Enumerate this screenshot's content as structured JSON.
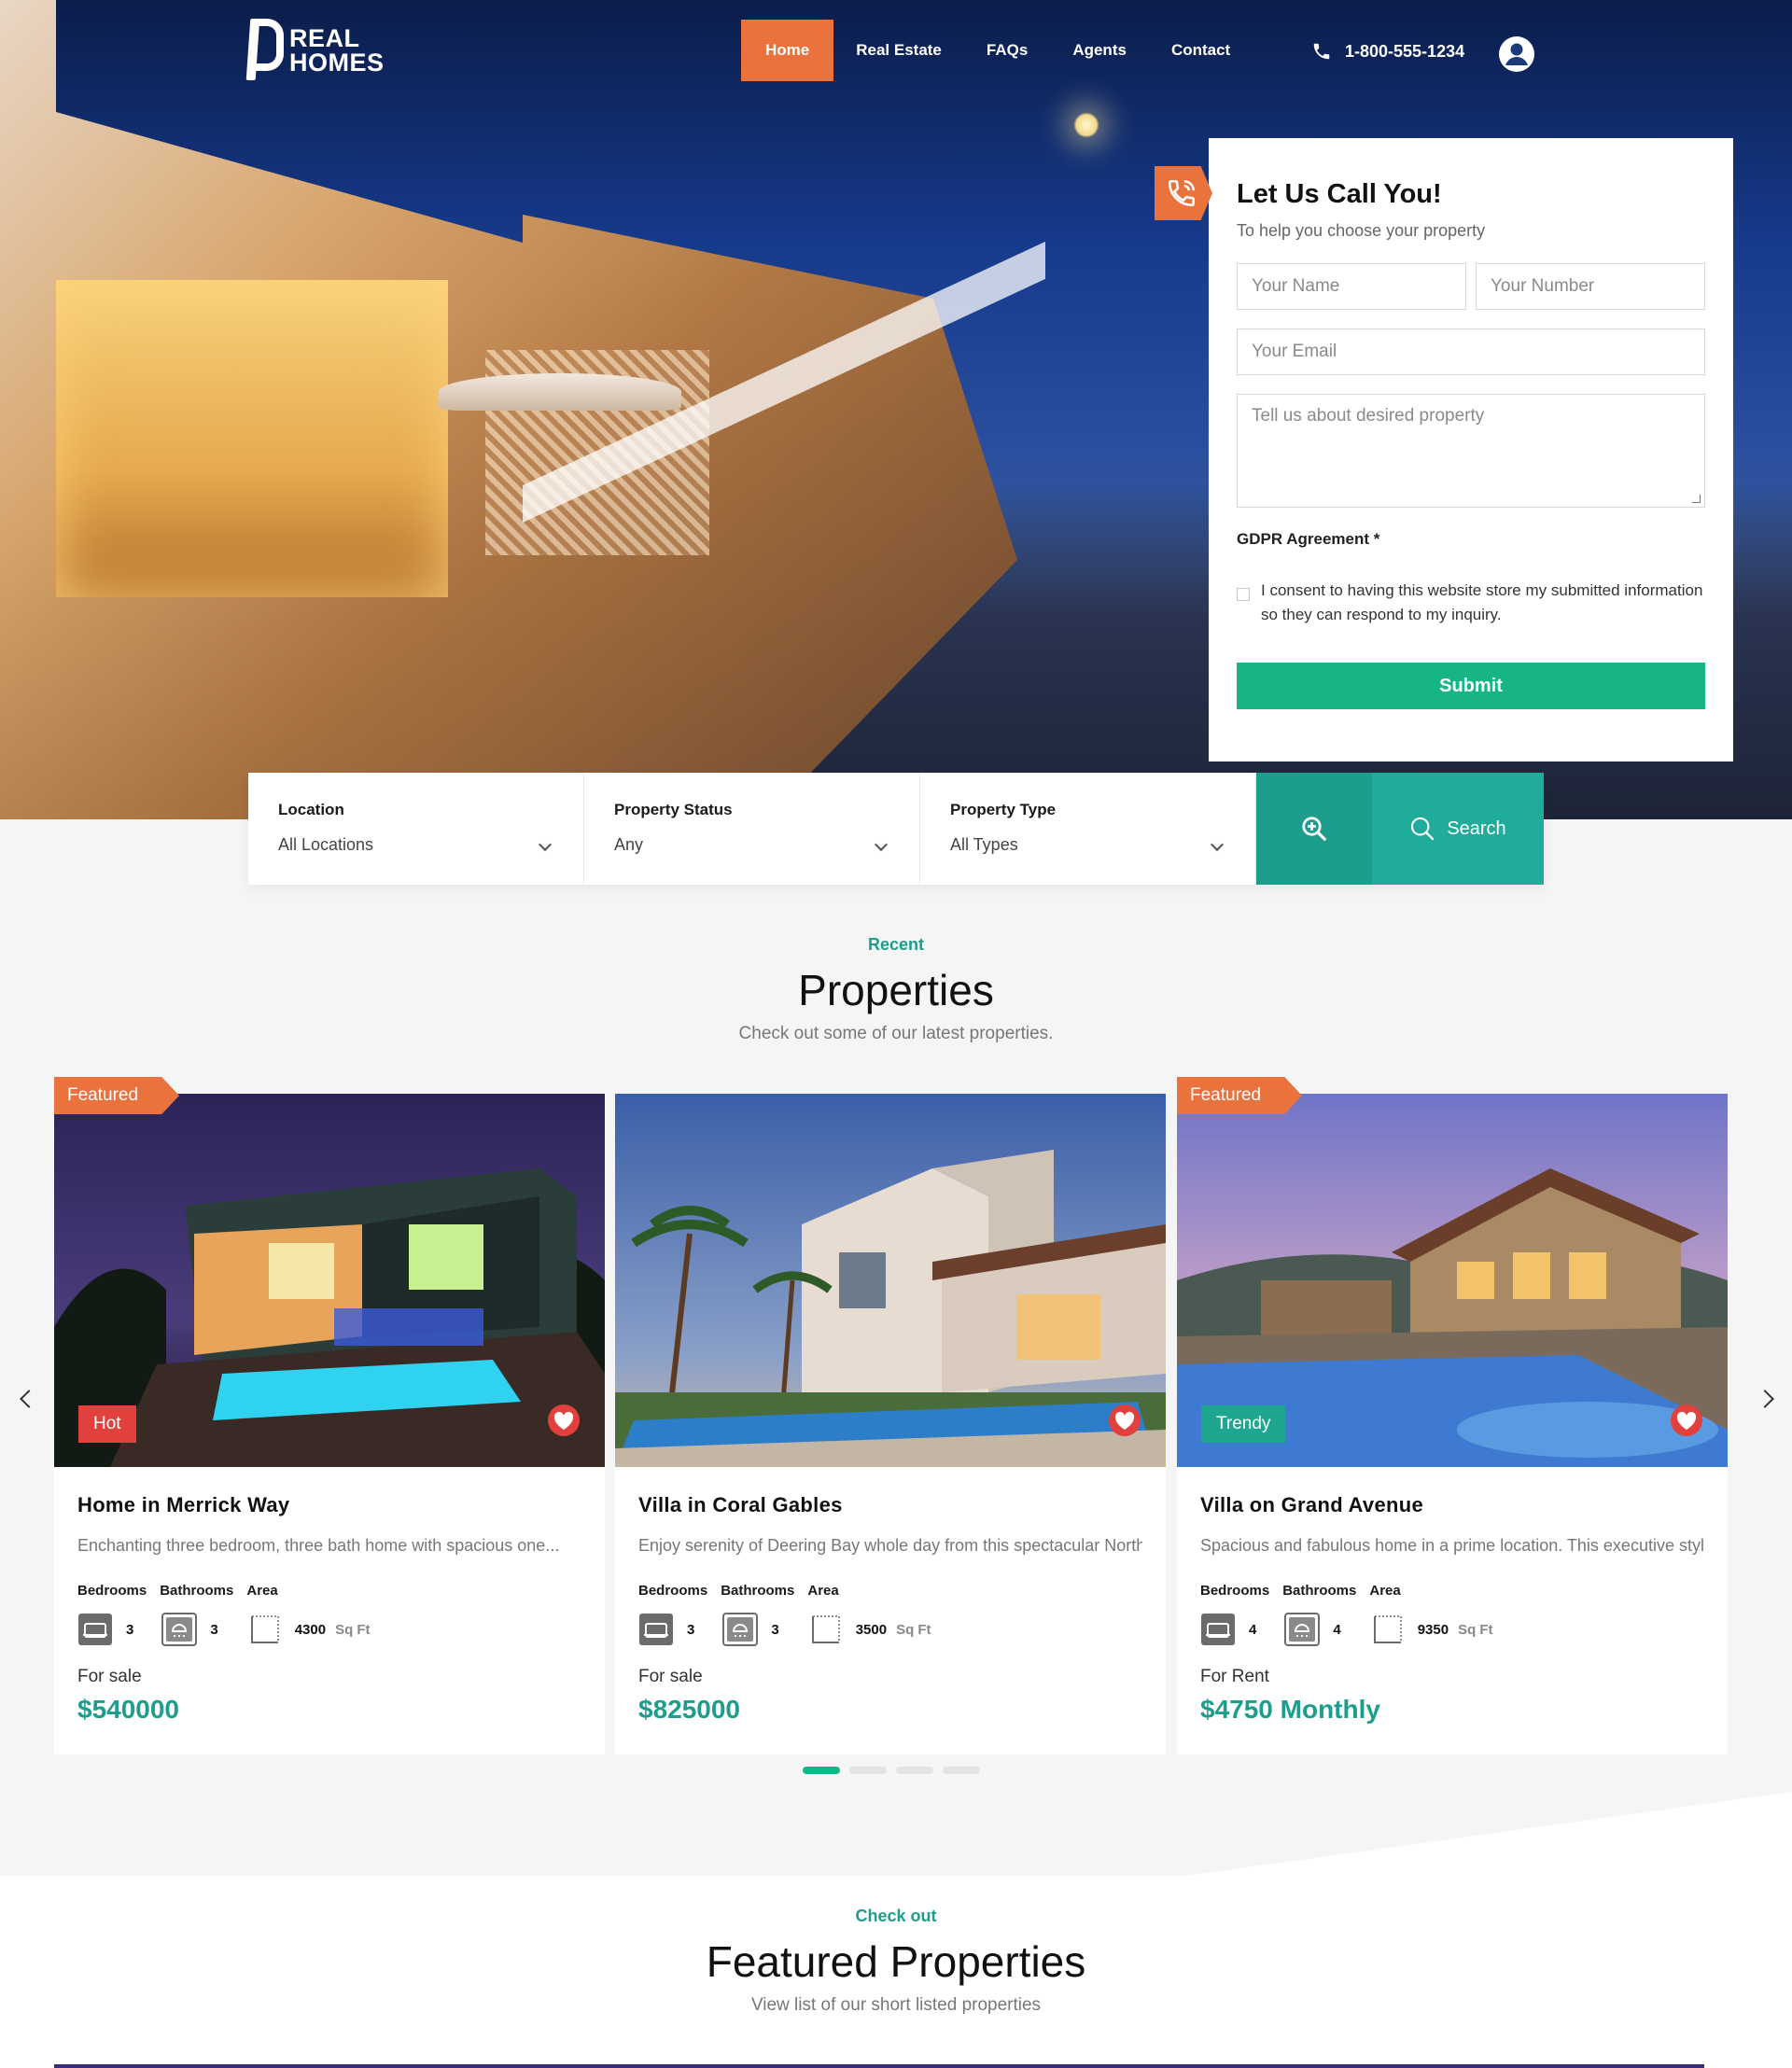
{
  "brand": {
    "name_line1": "REAL",
    "name_line2": "HOMES"
  },
  "nav": {
    "items": [
      {
        "label": "Home",
        "active": true
      },
      {
        "label": "Real Estate",
        "active": false
      },
      {
        "label": "FAQs",
        "active": false
      },
      {
        "label": "Agents",
        "active": false
      },
      {
        "label": "Contact",
        "active": false
      }
    ],
    "phone": "1-800-555-1234"
  },
  "callback": {
    "title": "Let Us Call You!",
    "subtitle": "To help you choose your property",
    "name_placeholder": "Your Name",
    "number_placeholder": "Your Number",
    "email_placeholder": "Your Email",
    "message_placeholder": "Tell us about desired property",
    "gdpr_title": "GDPR Agreement *",
    "consent_text": "I consent to having this website store my submitted information so they can respond to my inquiry.",
    "submit_label": "Submit"
  },
  "search": {
    "location_label": "Location",
    "location_value": "All Locations",
    "status_label": "Property Status",
    "status_value": "Any",
    "type_label": "Property Type",
    "type_value": "All Types",
    "search_label": "Search"
  },
  "recent": {
    "kicker": "Recent",
    "title": "Properties",
    "subtitle": "Check out some of our latest properties."
  },
  "properties": [
    {
      "featured": "Featured",
      "badge": "Hot",
      "title": "Home in Merrick Way",
      "description": "Enchanting three bedroom, three bath home with spacious one...",
      "bedrooms_label": "Bedrooms",
      "bathrooms_label": "Bathrooms",
      "area_label": "Area",
      "bedrooms": "3",
      "bathrooms": "3",
      "area": "4300",
      "area_unit": "Sq Ft",
      "status": "For sale",
      "price": "$540000"
    },
    {
      "featured": "",
      "badge": "",
      "title": "Villa in Coral Gables",
      "description": "Enjoy serenity of Deering Bay whole day from this spectacular North...",
      "bedrooms_label": "Bedrooms",
      "bathrooms_label": "Bathrooms",
      "area_label": "Area",
      "bedrooms": "3",
      "bathrooms": "3",
      "area": "3500",
      "area_unit": "Sq Ft",
      "status": "For sale",
      "price": "$825000"
    },
    {
      "featured": "Featured",
      "badge": "Trendy",
      "title": "Villa on Grand Avenue",
      "description": "Spacious and fabulous home in a prime location. This executive styl...",
      "bedrooms_label": "Bedrooms",
      "bathrooms_label": "Bathrooms",
      "area_label": "Area",
      "bedrooms": "4",
      "bathrooms": "4",
      "area": "9350",
      "area_unit": "Sq Ft",
      "status": "For Rent",
      "price": "$4750 Monthly"
    }
  ],
  "featured_section": {
    "kicker": "Check out",
    "title": "Featured Properties",
    "subtitle": "View list of our short listed properties"
  },
  "colors": {
    "accent_orange": "#ea723d",
    "accent_green": "#17b585",
    "teal": "#1d9e8c",
    "badge_hot": "#e2403c",
    "badge_trendy": "#1fa68e"
  }
}
